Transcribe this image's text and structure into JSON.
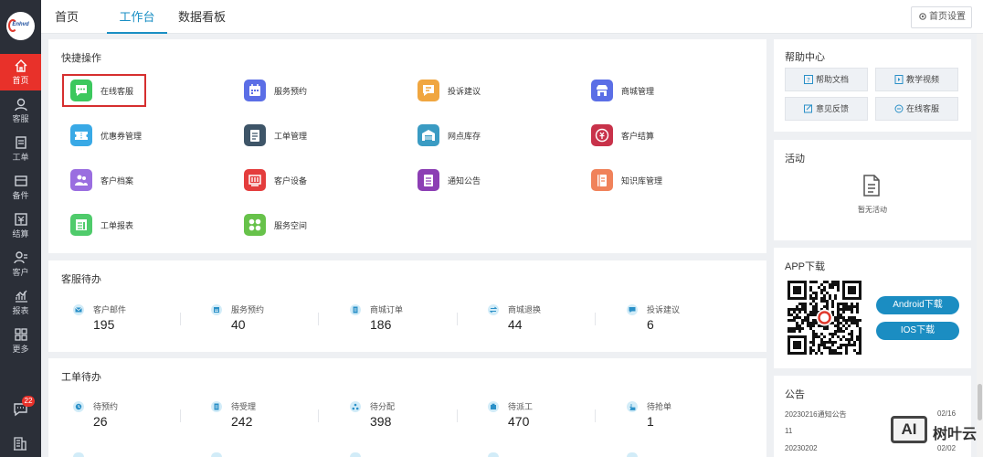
{
  "sidebar": {
    "nav": [
      {
        "label": "首页",
        "icon": "home-icon",
        "active": true
      },
      {
        "label": "客服",
        "icon": "headset-icon"
      },
      {
        "label": "工单",
        "icon": "ticket-icon"
      },
      {
        "label": "备件",
        "icon": "spare-parts-icon"
      },
      {
        "label": "结算",
        "icon": "settlement-icon"
      },
      {
        "label": "客户",
        "icon": "customer-icon"
      },
      {
        "label": "报表",
        "icon": "report-chart-icon"
      },
      {
        "label": "更多",
        "icon": "grid-more-icon"
      }
    ],
    "message_badge": "22",
    "accent_color": "#e8312a"
  },
  "topbar": {
    "tabs": [
      "首页",
      "工作台",
      "数据看板"
    ],
    "active_tab": "工作台",
    "home_settings_label": "首页设置"
  },
  "quick_actions": {
    "title": "快捷操作",
    "items": [
      {
        "label": "在线客服",
        "color": "#3cc85e",
        "icon": "chat-icon",
        "selected": true
      },
      {
        "label": "服务预约",
        "color": "#5b6ee6",
        "icon": "calendar-icon"
      },
      {
        "label": "投诉建议",
        "color": "#f0a640",
        "icon": "complaint-icon"
      },
      {
        "label": "商城管理",
        "color": "#5b6ee6",
        "icon": "shop-icon"
      },
      {
        "label": "优惠券管理",
        "color": "#39a9e6",
        "icon": "coupon-icon"
      },
      {
        "label": "工单管理",
        "color": "#3e5568",
        "icon": "ticket-icon"
      },
      {
        "label": "网点库存",
        "color": "#3a9bc3",
        "icon": "warehouse-icon"
      },
      {
        "label": "客户结算",
        "color": "#c8324a",
        "icon": "money-icon"
      },
      {
        "label": "客户档案",
        "color": "#9a6ee0",
        "icon": "people-icon"
      },
      {
        "label": "客户设备",
        "color": "#e43d3d",
        "icon": "device-icon"
      },
      {
        "label": "通知公告",
        "color": "#8c3eb4",
        "icon": "notice-icon"
      },
      {
        "label": "知识库管理",
        "color": "#f0825a",
        "icon": "book-icon"
      },
      {
        "label": "工单报表",
        "color": "#4fcb6b",
        "icon": "report-icon"
      },
      {
        "label": "服务空间",
        "color": "#67c24a",
        "icon": "apps-icon"
      }
    ]
  },
  "service_todo": {
    "title": "客服待办",
    "items": [
      {
        "label": "客户邮件",
        "value": "195",
        "icon": "mail-icon"
      },
      {
        "label": "服务预约",
        "value": "40",
        "icon": "calendar-icon"
      },
      {
        "label": "商城订单",
        "value": "186",
        "icon": "order-icon"
      },
      {
        "label": "商城退换",
        "value": "44",
        "icon": "exchange-icon"
      },
      {
        "label": "投诉建议",
        "value": "6",
        "icon": "complaint-icon"
      }
    ]
  },
  "ticket_todo": {
    "title": "工单待办",
    "items": [
      {
        "label": "待预约",
        "value": "26",
        "icon": "clock-icon"
      },
      {
        "label": "待受理",
        "value": "242",
        "icon": "doc-icon"
      },
      {
        "label": "待分配",
        "value": "398",
        "icon": "assign-icon"
      },
      {
        "label": "待派工",
        "value": "470",
        "icon": "dispatch-icon"
      },
      {
        "label": "待抢单",
        "value": "1",
        "icon": "grab-icon"
      }
    ]
  },
  "help": {
    "title": "帮助中心",
    "buttons": [
      {
        "label": "帮助文档",
        "icon": "help-doc-icon"
      },
      {
        "label": "教学视频",
        "icon": "video-icon"
      },
      {
        "label": "意见反馈",
        "icon": "feedback-icon"
      },
      {
        "label": "在线客服",
        "icon": "chat-icon"
      }
    ]
  },
  "activity": {
    "title": "活动",
    "empty_text": "暂无活动"
  },
  "app_download": {
    "title": "APP下载",
    "android_label": "Android下载",
    "ios_label": "IOS下载"
  },
  "announcements": {
    "title": "公告",
    "items": [
      {
        "text": "20230216通知公告",
        "date": "02/16"
      },
      {
        "text": "11",
        "date": ""
      },
      {
        "text": "20230202",
        "date": "02/02"
      }
    ]
  },
  "watermark": {
    "text": "树叶云",
    "ai_text": "AI"
  }
}
